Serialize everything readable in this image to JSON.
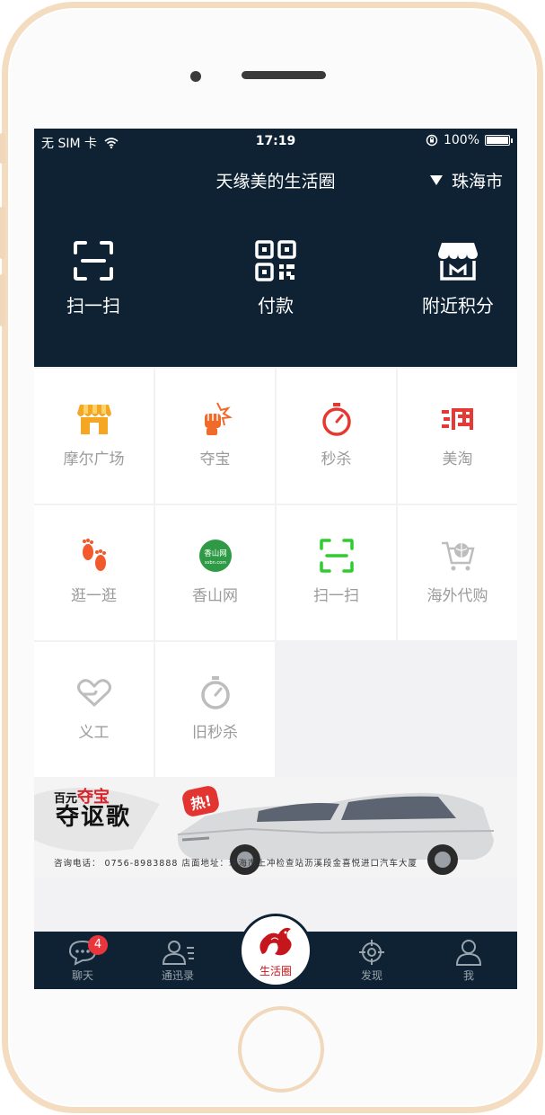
{
  "status": {
    "carrier": "无 SIM 卡",
    "time": "17:19",
    "battery": "100%"
  },
  "header": {
    "title": "天缘美的生活圈",
    "city": "珠海市"
  },
  "quick_actions": [
    {
      "label": "扫一扫",
      "icon": "scan-icon"
    },
    {
      "label": "付款",
      "icon": "qr-code-icon"
    },
    {
      "label": "附近积分",
      "icon": "store-icon"
    }
  ],
  "grid": [
    {
      "label": "摩尔广场",
      "icon": "shop-icon",
      "color": "#f5a623"
    },
    {
      "label": "夺宝",
      "icon": "fist-icon",
      "color": "#f06a29"
    },
    {
      "label": "秒杀",
      "icon": "stopwatch-icon",
      "color": "#e7372f"
    },
    {
      "label": "美淘",
      "icon": "tao-icon",
      "color": "#e53935"
    },
    {
      "label": "逛一逛",
      "icon": "footprints-icon",
      "color": "#f25a2c"
    },
    {
      "label": "香山网",
      "icon": "xiangshan-logo-icon",
      "color": "#2e9a45",
      "logo_text": "香山网",
      "logo_sub": "xsbn.com"
    },
    {
      "label": "扫一扫",
      "icon": "scan-icon",
      "color": "#2ecc2e"
    },
    {
      "label": "海外代购",
      "icon": "cart-globe-icon",
      "color": "#bdbdbd"
    },
    {
      "label": "义工",
      "icon": "heart-hand-icon",
      "color": "#bdbdbd"
    },
    {
      "label": "旧秒杀",
      "icon": "stopwatch-icon",
      "color": "#bdbdbd"
    }
  ],
  "banner": {
    "prefix": "百元",
    "highlight": "夺宝",
    "headline": "夺讴歌",
    "hot": "热!",
    "contact": "咨询电话：  0756-8983888   店面地址：珠海市上冲检查站沥溪段金喜悦进口汽车大厦"
  },
  "tabbar": {
    "chat": "聊天",
    "chat_badge": "4",
    "contacts": "通迅录",
    "life": "生活圈",
    "discover": "发现",
    "me": "我"
  },
  "colors": {
    "dark": "#0e2233",
    "badge": "#e8363c",
    "brand_red": "#c4161c"
  }
}
